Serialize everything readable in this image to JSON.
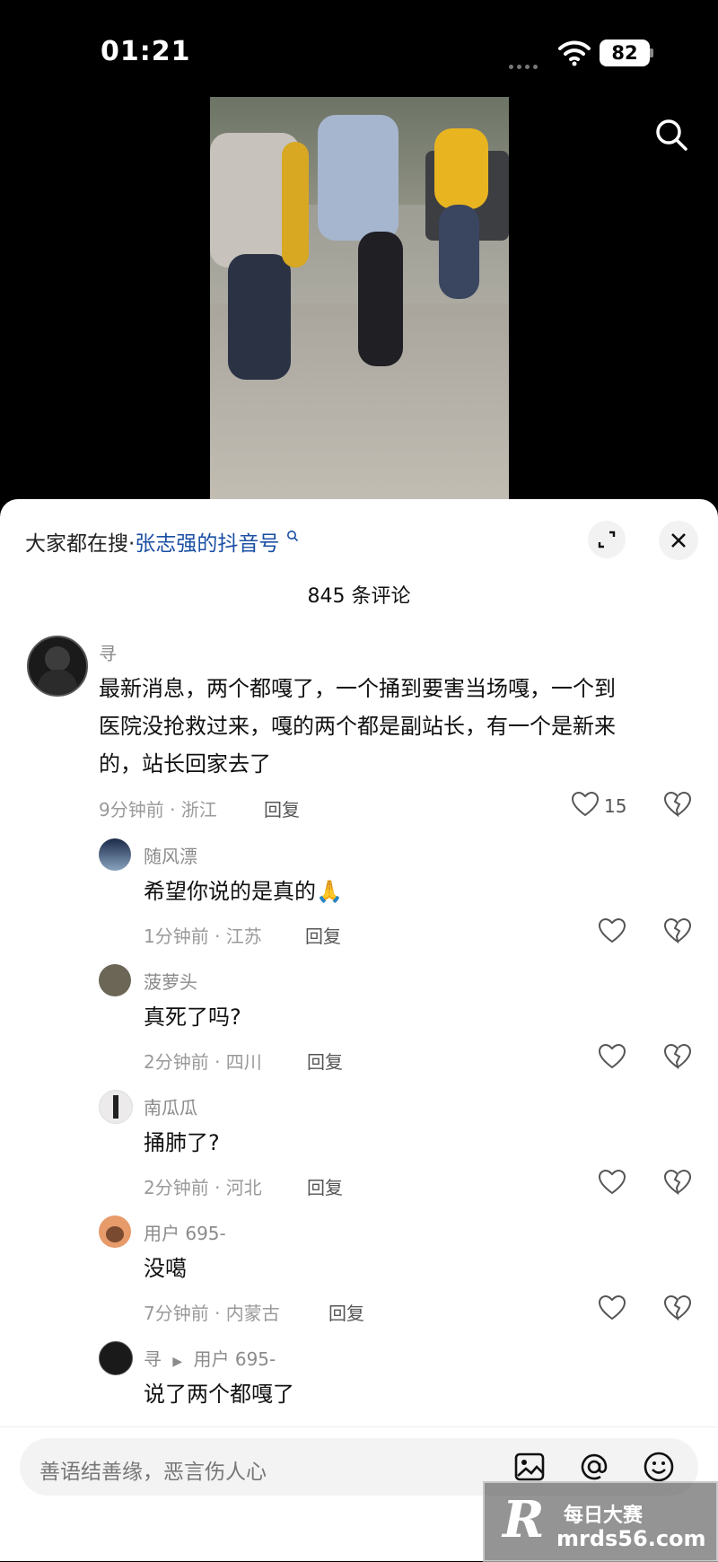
{
  "status": {
    "time": "01:21",
    "battery": "82"
  },
  "video": {
    "caption": ""
  },
  "sheet": {
    "searching_prefix": "大家都在搜·",
    "searching_link": "张志强的抖音号",
    "comment_count": "845 条评论"
  },
  "comments": [
    {
      "user": "寻",
      "text_lines": [
        "最新消息，两个都嘎了，一个捅到要害当场嘎，一个到",
        "医院没抢救过来，嘎的两个都是副站长，有一个是新来",
        "的，站长回家去了"
      ],
      "time_loc": "9分钟前 · 浙江",
      "reply": "回复",
      "likes": "15"
    }
  ],
  "replies": [
    {
      "user": "随风漂",
      "text": "希望你说的是真的",
      "emoji": "🙏",
      "time_loc": "1分钟前 · 江苏",
      "reply": "回复"
    },
    {
      "user": "菠萝头",
      "text": "真死了吗?",
      "time_loc": "2分钟前 · 四川",
      "reply": "回复"
    },
    {
      "user": "南瓜瓜",
      "text": "捅肺了?",
      "time_loc": "2分钟前 · 河北",
      "reply": "回复"
    },
    {
      "user": "用户 695-",
      "text": "没噶",
      "time_loc": "7分钟前 · 内蒙古",
      "reply": "回复"
    },
    {
      "user": "寻",
      "reply_to": "用户 695-",
      "text": "说了两个都嘎了"
    }
  ],
  "input": {
    "placeholder": "善语结善缘，恶言伤人心"
  },
  "watermark": {
    "top": "每日大赛",
    "url": "mrds56.com",
    "logo": "R"
  },
  "icons": [
    "wifi-icon",
    "search-icon",
    "expand-icon",
    "close-icon",
    "heart-icon",
    "broken-heart-icon",
    "image-icon",
    "at-icon",
    "emoji-icon"
  ]
}
